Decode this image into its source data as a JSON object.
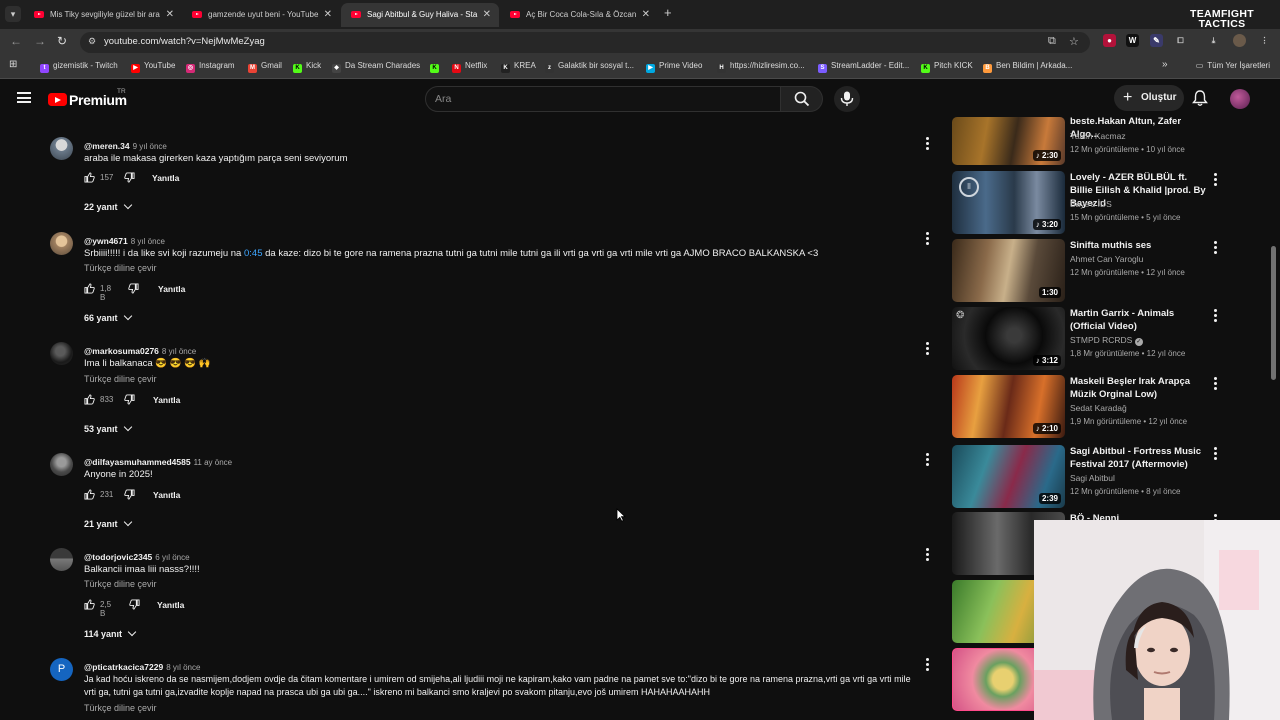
{
  "browser": {
    "tabs": [
      {
        "title": "Mis Tiky sevgiliyle güzel bir ara"
      },
      {
        "title": "gamzende uyut beni - YouTube"
      },
      {
        "title": "Sagi Abitbul & Guy Haliva - Sta"
      },
      {
        "title": "Aç Bir Coca Cola-Sıla & Özcan"
      }
    ],
    "url": "youtube.com/watch?v=NejMwMeZyag",
    "overlay_brand": "TEAMFIGHT TACTICS",
    "bookmarks": [
      {
        "label": "gizemistik - Twitch",
        "color": "#9146ff",
        "glyph": "t"
      },
      {
        "label": "YouTube",
        "color": "#ff0000",
        "glyph": "▶"
      },
      {
        "label": "Instagram",
        "color": "#d62976",
        "glyph": "◎"
      },
      {
        "label": "Gmail",
        "color": "#ea4335",
        "glyph": "M"
      },
      {
        "label": "Kick",
        "color": "#53fc18",
        "glyph": "K"
      },
      {
        "label": "Da Stream Charades",
        "color": "#444444",
        "glyph": "◆"
      },
      {
        "label": "",
        "color": "#53fc18",
        "glyph": "K"
      },
      {
        "label": "Netflix",
        "color": "#e50914",
        "glyph": "N"
      },
      {
        "label": "KREA",
        "color": "#222222",
        "glyph": "K"
      },
      {
        "label": "Galaktik bir sosyal t...",
        "color": "#333333",
        "glyph": "zk"
      },
      {
        "label": "Prime Video",
        "color": "#00a8e1",
        "glyph": "▶"
      },
      {
        "label": "https://hizliresim.co...",
        "color": "#333333",
        "glyph": "H"
      },
      {
        "label": "StreamLadder - Edit...",
        "color": "#7b5cff",
        "glyph": "SL"
      },
      {
        "label": "Pitch KICK",
        "color": "#53fc18",
        "glyph": "K"
      },
      {
        "label": "Ben Bildim | Arkada...",
        "color": "#ff9a3c",
        "glyph": "B"
      }
    ],
    "bookmarks_more": "»",
    "all_bookmarks": "Tüm Yer İşaretleri"
  },
  "youtube": {
    "logo_text": "Premium",
    "logo_region": "TR",
    "search_placeholder": "Ara",
    "create_label": "Oluştur"
  },
  "comments": [
    {
      "user": "@meren.34",
      "time": "9 yıl önce",
      "text": "araba ile makasa girerken kaza yaptığım parça seni seviyorum",
      "likes": "157",
      "reply": "Yanıtla",
      "replies": "22 yanıt"
    },
    {
      "user": "@ywn4671",
      "time": "8 yıl önce",
      "text_pre": "Srbiiii!!!!! i da like svi koji razumeju na ",
      "timestamp": "0:45",
      "text_post": " da kaze: dizo bi te gore na ramena prazna tutni ga tutni mile tutni ga ili vrti ga vrti ga  vrti mile vrti ga AJMO BRACO BALKANSKA <3",
      "translate": "Türkçe diline çevir",
      "likes": "1,8 B",
      "reply": "Yanıtla",
      "replies": "66 yanıt"
    },
    {
      "user": "@markosuma0276",
      "time": "8 yıl önce",
      "text": "Ima li balkanaca 😎 😎 😎 🙌",
      "translate": "Türkçe diline çevir",
      "likes": "833",
      "reply": "Yanıtla",
      "replies": "53 yanıt"
    },
    {
      "user": "@dilfayasmuhammed4585",
      "time": "11 ay önce",
      "text": "Anyone in 2025!",
      "likes": "231",
      "reply": "Yanıtla",
      "replies": "21 yanıt"
    },
    {
      "user": "@todorjovic2345",
      "time": "6 yıl önce",
      "text": "Balkancii imaa liii nasss?!!!!",
      "translate": "Türkçe diline çevir",
      "likes": "2,5 B",
      "reply": "Yanıtla",
      "replies": "114 yanıt"
    },
    {
      "user": "@pticatrkacica7229",
      "time": "8 yıl önce",
      "avatar_letter": "P",
      "text": "Ja kad hoću iskreno da se nasmijem,dodjem ovdje da čitam komentare i umirem od smijeha,ali ljudiii moji ne kapiram,kako vam padne na pamet sve to:\"dizo bi te gore na ramena prazna,vrti ga vrti ga vrti mile",
      "text2": "vrti ga, tutni ga tutni ga,izvadite koplje napad na prasca ubi ga ubi ga....\" iskreno mi balkanci smo kraljevi po svakom pitanju,evo još umirem HAHAHAAHAHH",
      "translate": "Türkçe diline çevir"
    }
  ],
  "recommendations": [
    {
      "title": "beste.Hakan Altun, Zafer Algo...",
      "channel": "Yalcin Kacmaz",
      "meta": "12 Mn görüntüleme • 10 yıl önce",
      "duration": "♪ 2:30"
    },
    {
      "title": "Lovely - AZER BÜLBÜL ft. Billie Eilish & Khalid |prod. By Bayezid",
      "channel": "Baye's IDS",
      "meta": "15 Mn görüntüleme • 5 yıl önce",
      "duration": "♪ 3:20"
    },
    {
      "title": "Sinifta muthis ses",
      "channel": "Ahmet Can Yaroglu",
      "meta": "12 Mn görüntüleme • 12 yıl önce",
      "duration": "1:30"
    },
    {
      "title": "Martin Garrix - Animals (Official Video)",
      "channel": "STMPD RCRDS",
      "meta": "1,8 Mr görüntüleme • 12 yıl önce",
      "duration": "♪ 3:12"
    },
    {
      "title": "Maskeli Beşler Irak Arapça Müzik Orginal Low)",
      "channel": "Sedat Karadağ",
      "meta": "1,9 Mn görüntüleme • 12 yıl önce",
      "duration": "♪ 2:10"
    },
    {
      "title": "Sagi Abitbul - Fortress Music Festival 2017 (Aftermovie)",
      "channel": "Sagi Abitbul",
      "meta": "12 Mn görüntüleme • 8 yıl önce",
      "duration": "2:39"
    },
    {
      "title": "BÖ - Nenni",
      "channel": "",
      "meta": "",
      "duration": ""
    }
  ]
}
